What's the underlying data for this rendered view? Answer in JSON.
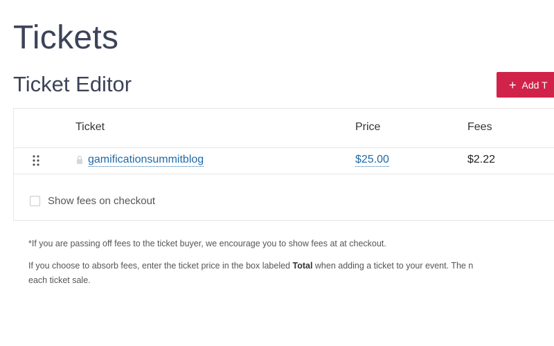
{
  "page": {
    "title": "Tickets"
  },
  "editor": {
    "title": "Ticket Editor",
    "add_button_label": "Add T"
  },
  "table": {
    "headers": {
      "ticket": "Ticket",
      "price": "Price",
      "fees": "Fees"
    },
    "rows": [
      {
        "name": "gamificationsummitblog",
        "price": "$25.00",
        "fees": "$2.22"
      }
    ]
  },
  "show_fees": {
    "label": "Show fees on checkout",
    "checked": false
  },
  "notes": {
    "line1": "*If you are passing off fees to the ticket buyer, we encourage you to show fees at at checkout.",
    "line2_before": "If you choose to absorb fees, enter the ticket price in the box labeled ",
    "line2_bold": "Total",
    "line2_after": " when adding a ticket to your event. The n",
    "line2_wrap": "each ticket sale."
  },
  "colors": {
    "accent": "#d1234a",
    "link": "#1e6aa8",
    "heading": "#3d4358"
  },
  "icons": {
    "drag": "drag-handle-icon",
    "lock": "lock-icon",
    "plus": "plus-icon"
  }
}
